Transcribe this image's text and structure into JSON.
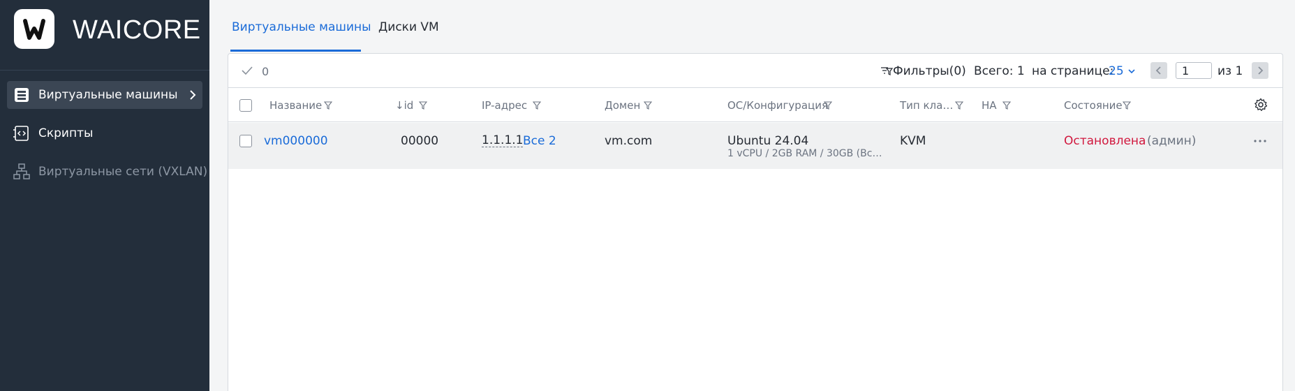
{
  "app": {
    "brand": "WAICORE",
    "logo_letter": "W"
  },
  "sidebar": {
    "items": [
      {
        "label": "Виртуальные машины",
        "icon": "server-icon",
        "active": true
      },
      {
        "label": "Скрипты",
        "icon": "script-icon",
        "active": false
      },
      {
        "label": "Виртуальные сети (VXLAN)",
        "icon": "network-icon",
        "active": false,
        "disabled": true
      }
    ]
  },
  "tabs": [
    {
      "label": "Виртуальные машины",
      "active": true
    },
    {
      "label": "Диски VM",
      "active": false
    }
  ],
  "toolbar": {
    "selected_count": "0",
    "filters_label": "Фильтры(0)",
    "total_label": "Всего: 1",
    "per_page_label": "на странице:",
    "per_page_value": "25",
    "page_value": "1",
    "page_of_label": "из  1"
  },
  "table": {
    "columns": {
      "name": "Название",
      "id": "↓id",
      "ip": "IP-адрес",
      "domain": "Домен",
      "os": "ОС/Конфигурация",
      "cluster_type": "Тип кла…",
      "ha": "HA",
      "state": "Состояние"
    },
    "rows": [
      {
        "name": "vm000000",
        "id": "00000",
        "ip": "1.1.1.1",
        "ip_all": "Все 2",
        "domain": "vm.com",
        "os": "Ubuntu 24.04",
        "config": "1 vCPU / 2GB RAM / 30GB (Все…",
        "cluster_type": "KVM",
        "ha": "",
        "state": "Остановлена",
        "state_by": "(админ)"
      }
    ]
  },
  "colors": {
    "sidebar_bg": "#232e3b",
    "accent": "#1a6bd8",
    "status_stopped": "#d1183e"
  }
}
